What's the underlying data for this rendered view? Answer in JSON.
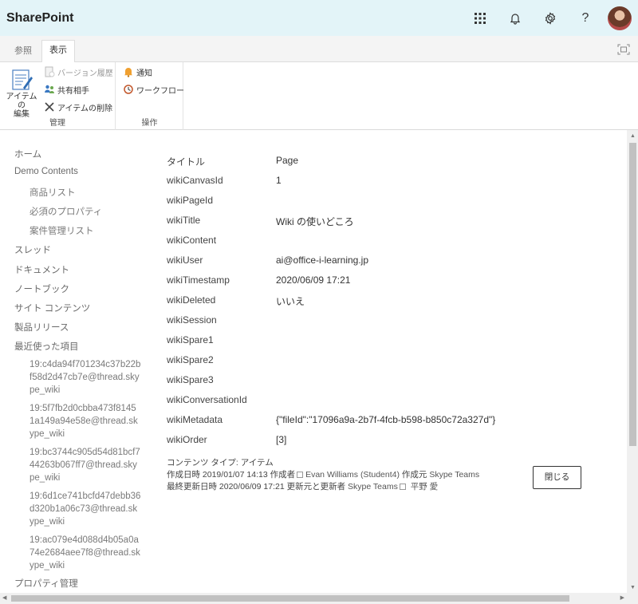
{
  "suite": {
    "brand": "SharePoint",
    "help_glyph": "?",
    "icons": [
      "app-launcher-icon",
      "bell-icon",
      "gear-icon",
      "help-icon",
      "avatar"
    ]
  },
  "ribbon": {
    "tabs": [
      {
        "label": "参照",
        "active": false
      },
      {
        "label": "表示",
        "active": true
      }
    ],
    "groups": {
      "manage": {
        "label": "管理",
        "edit_item": "アイテムの編集",
        "edit_item_line1": "アイテムの",
        "edit_item_line2": "編集",
        "version_history": "バージョン履歴",
        "shared_with": "共有相手",
        "delete_item": "アイテムの削除"
      },
      "ops": {
        "label": "操作",
        "alert": "通知",
        "workflow": "ワークフロー"
      }
    }
  },
  "leftnav": {
    "items": [
      "ホーム",
      "Demo Contents",
      "商品リスト",
      "必須のプロパティ",
      "案件管理リスト",
      "スレッド",
      "ドキュメント",
      "ノートブック",
      "サイト コンテンツ",
      "製品リリース",
      "最近使った項目"
    ],
    "recent": [
      "19:c4da94f701234c37b22bf58d2d47cb7e@thread.skype_wiki",
      "19:5f7fb2d0cbba473f81451a149a94e58e@thread.skype_wiki",
      "19:bc3744c905d54d81bcf744263b067ff7@thread.skype_wiki",
      "19:6d1ce741bcfd47debb36d320b1a06c73@thread.skype_wiki",
      "19:ac079e4d088d4b05a0a74e2684aee7f8@thread.skype_wiki"
    ],
    "last": "プロパティ管理"
  },
  "form": {
    "fields": [
      {
        "label": "タイトル",
        "value": "Page"
      },
      {
        "label": "wikiCanvasId",
        "value": "1"
      },
      {
        "label": "wikiPageId",
        "value": ""
      },
      {
        "label": "wikiTitle",
        "value": "Wiki の使いどころ"
      },
      {
        "label": "wikiContent",
        "value": ""
      },
      {
        "label": "wikiUser",
        "value": "ai@office-i-learning.jp"
      },
      {
        "label": "wikiTimestamp",
        "value": "2020/06/09 17:21"
      },
      {
        "label": "wikiDeleted",
        "value": "いいえ"
      },
      {
        "label": "wikiSession",
        "value": ""
      },
      {
        "label": "wikiSpare1",
        "value": ""
      },
      {
        "label": "wikiSpare2",
        "value": ""
      },
      {
        "label": "wikiSpare3",
        "value": ""
      },
      {
        "label": "wikiConversationId",
        "value": ""
      },
      {
        "label": "wikiMetadata",
        "value": "{\"fileId\":\"17096a9a-2b7f-4fcb-b598-b850c72a327d\"}"
      },
      {
        "label": "wikiOrder",
        "value": "[3]"
      }
    ],
    "meta": {
      "content_type": "コンテンツ タイプ: アイテム",
      "created_prefix": "作成日時 2019/01/07 14:13  作成者",
      "created_by": "Evan Williams (Student4)",
      "created_app_label": "作成元",
      "created_app": "Skype Teams",
      "modified_prefix": "最終更新日時 2020/06/09 17:21  更新元と更新者",
      "modified_app": "Skype Teams",
      "modified_by": "平野 愛"
    },
    "close_label": "閉じる"
  }
}
